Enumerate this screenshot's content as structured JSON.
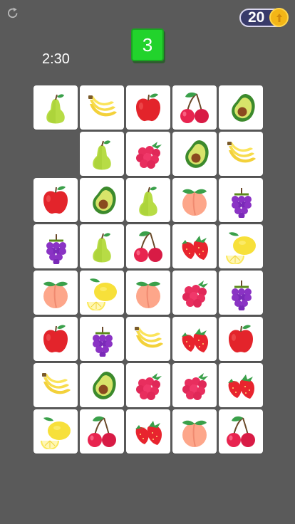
{
  "hud": {
    "coins": "20",
    "level": "3",
    "timer": "2:30"
  },
  "board": {
    "rows": [
      [
        "pear",
        "banana",
        "apple",
        "cherry",
        "avocado"
      ],
      [
        null,
        "pear",
        "raspberry",
        "avocado",
        "banana"
      ],
      [
        "apple",
        "avocado",
        "pear",
        "peach",
        "grapes"
      ],
      [
        "grapes",
        "pear",
        "cherry",
        "strawberry",
        "lemon"
      ],
      [
        "peach",
        "lemon",
        "peach",
        "raspberry",
        "grapes"
      ],
      [
        "apple",
        "grapes",
        "banana",
        "strawberry",
        "apple"
      ],
      [
        "banana",
        "avocado",
        "raspberry",
        "raspberry",
        "strawberry"
      ],
      [
        "lemon",
        "cherry",
        "strawberry",
        "peach",
        "cherry"
      ]
    ]
  }
}
